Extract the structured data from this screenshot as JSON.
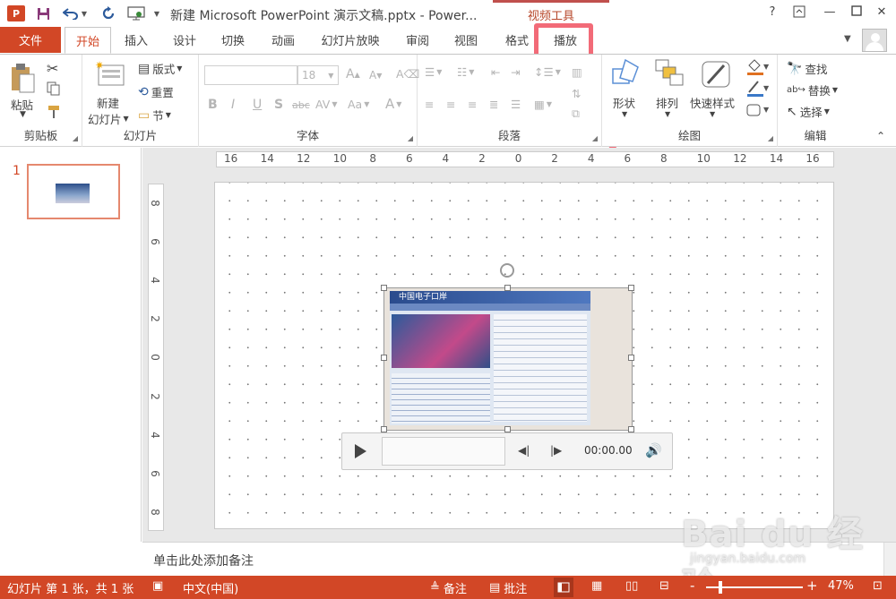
{
  "colors": {
    "accent": "#d24726",
    "callout": "#f26b78"
  },
  "titlebar": {
    "app_logo": "P",
    "document_title": "新建 Microsoft PowerPoint 演示文稿.pptx - Power...",
    "context_group": "视频工具",
    "help": "?",
    "icons": [
      "powerpoint-logo",
      "save-icon",
      "undo-icon",
      "redo-icon",
      "slideshow-icon"
    ]
  },
  "tabs": {
    "file": "文件",
    "items": [
      "开始",
      "插入",
      "设计",
      "切换",
      "动画",
      "幻灯片放映",
      "审阅",
      "视图",
      "格式",
      "播放"
    ],
    "active": "开始",
    "highlighted": "播放"
  },
  "ribbon": {
    "clipboard": {
      "label": "剪贴板",
      "paste": "粘贴"
    },
    "slides": {
      "label": "幻灯片",
      "new_slide_line1": "新建",
      "new_slide_line2": "幻灯片",
      "layout": "版式",
      "reset": "重置",
      "section": "节"
    },
    "font": {
      "label": "字体",
      "size": "18",
      "bold": "B",
      "italic": "I",
      "underline": "U",
      "shadow": "S",
      "strike": "abc",
      "spacing": "AV",
      "case": "Aa",
      "color": "A",
      "grow": "A",
      "shrink": "A"
    },
    "paragraph": {
      "label": "段落"
    },
    "drawing": {
      "label": "绘图",
      "shapes": "形状",
      "arrange": "排列",
      "quick_styles": "快速样式"
    },
    "editing": {
      "label": "编辑",
      "find": "查找",
      "replace": "替换",
      "select": "选择"
    }
  },
  "thumbnails": {
    "slide_number": "1"
  },
  "rulers": {
    "horizontal": [
      "16",
      "14",
      "12",
      "10",
      "8",
      "6",
      "4",
      "2",
      "0",
      "2",
      "4",
      "6",
      "8",
      "10",
      "12",
      "14",
      "16"
    ],
    "vertical": [
      "8",
      "6",
      "4",
      "2",
      "0",
      "2",
      "4",
      "6",
      "8"
    ]
  },
  "video": {
    "site_header": "中国电子口岸"
  },
  "media_controls": {
    "time": "00:00.00"
  },
  "notes": {
    "placeholder": "单击此处添加备注"
  },
  "statusbar": {
    "slide_info": "幻灯片 第 1 张，共 1 张",
    "language": "中文(中国)",
    "notes": "备注",
    "comments": "批注",
    "zoom_minus": "-",
    "zoom_plus": "+",
    "zoom": "47%"
  },
  "watermark": {
    "logo": "Bai du 经验",
    "url": "jingyan.baidu.com"
  }
}
